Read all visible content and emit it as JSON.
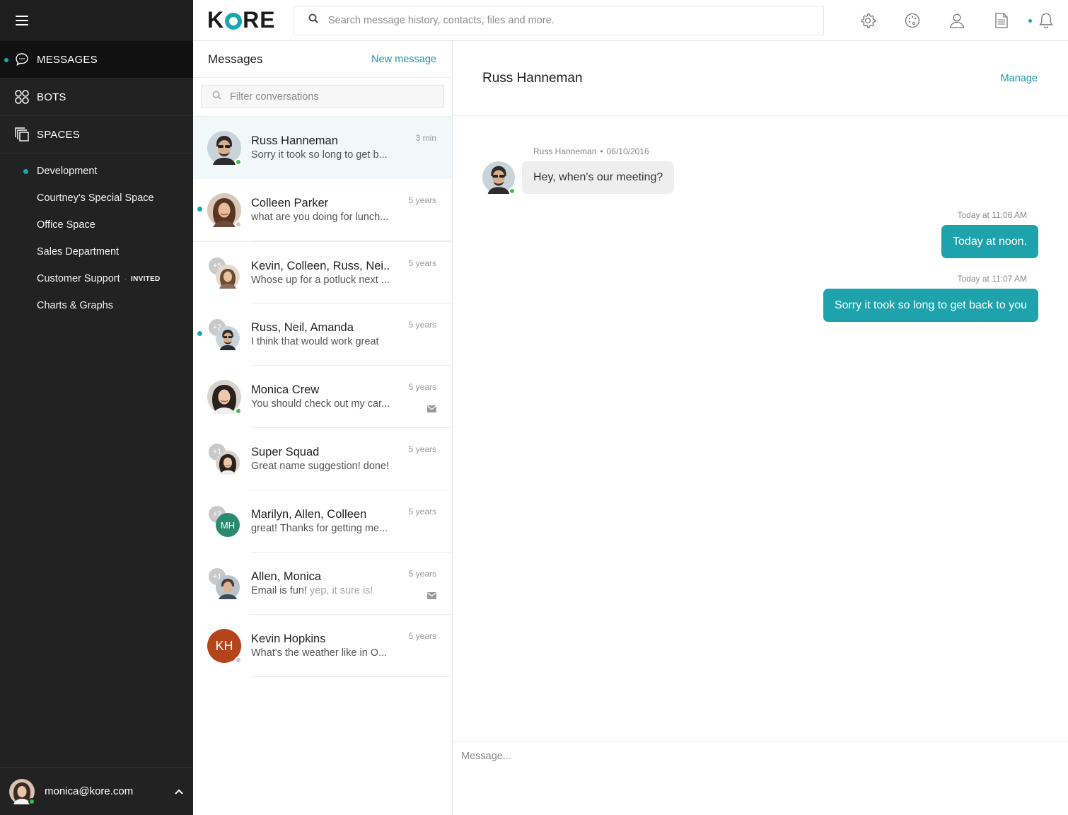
{
  "nav": {
    "items": [
      {
        "label": "MESSAGES",
        "icon": "chat-bubble-icon",
        "active": true
      },
      {
        "label": "BOTS",
        "icon": "bots-icon"
      },
      {
        "label": "SPACES",
        "icon": "spaces-icon"
      }
    ],
    "spaces": [
      {
        "label": "Development",
        "unread": true
      },
      {
        "label": "Courtney's Special Space"
      },
      {
        "label": "Office Space"
      },
      {
        "label": "Sales Department"
      },
      {
        "label": "Customer Support",
        "badge": "INVITED",
        "sep": "·"
      },
      {
        "label": "Charts & Graphs"
      }
    ],
    "user_email": "monica@kore.com"
  },
  "topbar": {
    "logo": {
      "before": "K",
      "after": "RE"
    },
    "search_placeholder": "Search message history, contacts, files and more."
  },
  "conversations": {
    "title": "Messages",
    "new_message": "New message",
    "filter_placeholder": "Filter conversations",
    "items": [
      {
        "name": "Russ Hanneman",
        "preview": "Sorry it took so long to get b...",
        "time": "3 min"
      },
      {
        "name": "Colleen Parker",
        "preview": "what are you doing for lunch...",
        "time": "5 years"
      },
      {
        "name": "Kevin, Colleen, Russ, Nei...",
        "preview": "Whose up for a potluck next ...",
        "time": "5 years",
        "plus": "+5"
      },
      {
        "name": "Russ, Neil, Amanda",
        "preview": "I think that would work great",
        "time": "5 years",
        "plus": "+2"
      },
      {
        "name": "Monica Crew",
        "preview": "You should check out my car...",
        "time": "5 years"
      },
      {
        "name": "Super Squad",
        "preview": "Great name suggestion! done!",
        "time": "5 years",
        "plus": "+1"
      },
      {
        "name": "Marilyn, Allen, Colleen",
        "preview": "great! Thanks for getting me...",
        "time": "5 years",
        "plus": "+2",
        "initials": "MH"
      },
      {
        "name": "Allen, Monica",
        "preview": "Email is fun!",
        "preview_muted": "yep, it sure is!",
        "time": "5 years",
        "plus": "+1"
      },
      {
        "name": "Kevin Hopkins",
        "preview": "What's the weather like in O...",
        "time": "5 years",
        "initials": "KH"
      }
    ]
  },
  "chat": {
    "title": "Russ Hanneman",
    "manage": "Manage",
    "incoming": {
      "sender": "Russ Hanneman",
      "sep": "•",
      "date": "06/10/2016",
      "text": "Hey, when's our meeting?"
    },
    "outgoing": [
      {
        "time": "Today at 11:06 AM",
        "text": "Today at noon."
      },
      {
        "time": "Today at 11:07 AM",
        "text": "Sorry it took so long to get back to you"
      }
    ],
    "composer_placeholder": "Message..."
  },
  "colors": {
    "accent": "#16a8b5",
    "bubble_out": "#1ea3ad",
    "nav_bg": "#222222",
    "online": "#3bbf4a"
  }
}
